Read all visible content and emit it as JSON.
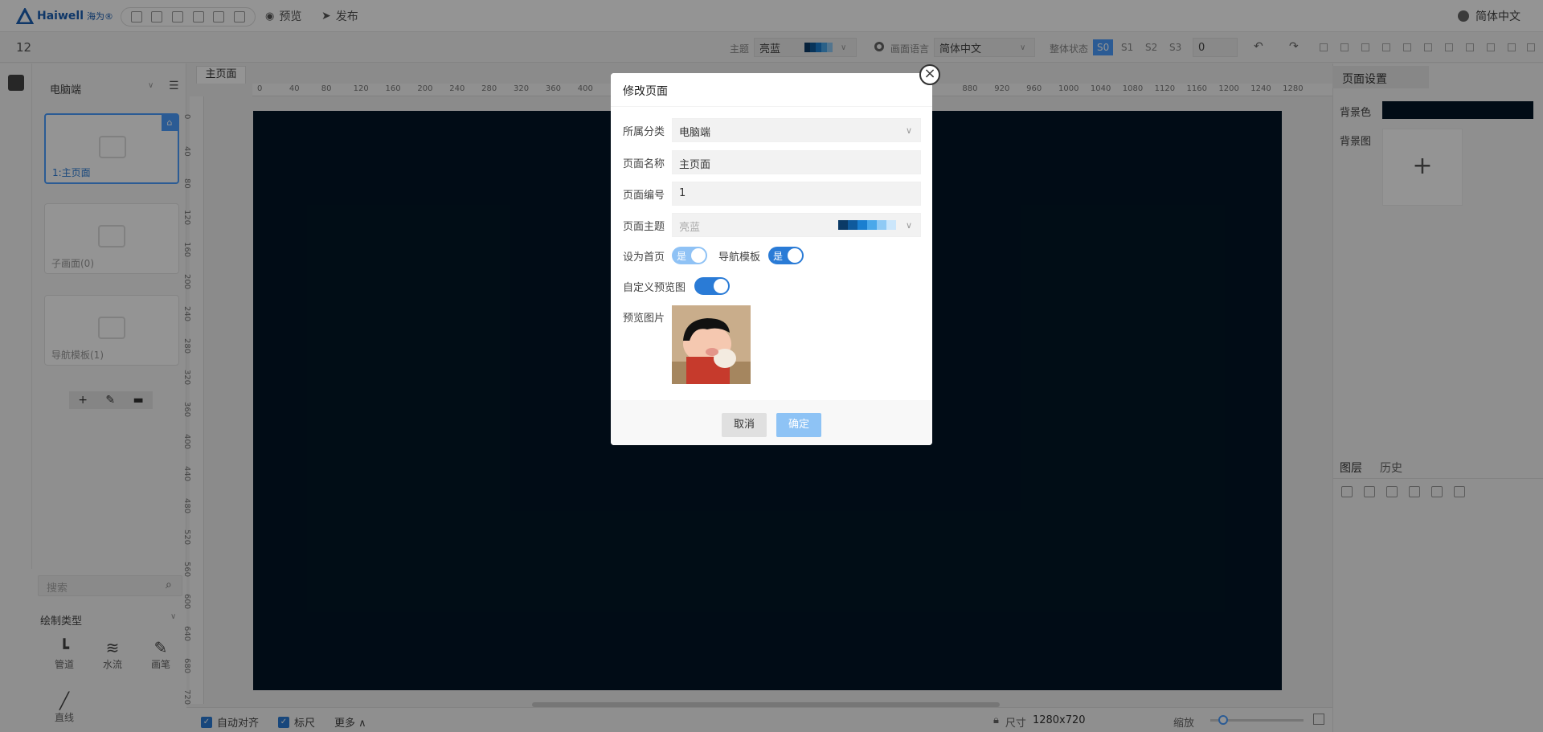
{
  "app": {
    "logo_text": "Haiwell",
    "logo_sub": "海为®",
    "preview_label": "预览",
    "publish_label": "发布",
    "language": "简体中文"
  },
  "toolbar": {
    "page_count": "12",
    "theme_label": "主题",
    "theme_value": "亮蓝",
    "screen_lang_label": "画面语言",
    "screen_lang_value": "简体中文",
    "state_label": "整体状态",
    "states": [
      "S0",
      "S1",
      "S2",
      "S3"
    ],
    "state_value": "0"
  },
  "left": {
    "category": "电脑端",
    "pages": [
      "1:主页面",
      "子画面(0)",
      "导航模板(1)"
    ],
    "search_placeholder": "搜索",
    "draw_type_label": "绘制类型",
    "tools": [
      "管道",
      "水流",
      "画笔",
      "直线"
    ]
  },
  "canvas": {
    "tab_label": "主页面",
    "ruler_top": [
      "0",
      "40",
      "80",
      "120",
      "160",
      "200",
      "240",
      "280",
      "320",
      "360",
      "400",
      "880",
      "920",
      "960",
      "1000",
      "1040",
      "1080",
      "1120",
      "1160",
      "1200",
      "1240",
      "1280"
    ],
    "ruler_left": [
      "0",
      "40",
      "80",
      "120",
      "160",
      "200",
      "240",
      "280",
      "320",
      "360",
      "400",
      "440",
      "480",
      "520",
      "560",
      "600",
      "640",
      "680",
      "720"
    ]
  },
  "right": {
    "title": "页面设置",
    "bg_color_label": "背景色",
    "bg_image_label": "背景图",
    "add_symbol": "+",
    "tab_layers": "图层",
    "tab_history": "历史",
    "bg_color": "#021626"
  },
  "bottom": {
    "auto_align": "自动对齐",
    "ruler": "标尺",
    "more": "更多",
    "size_label": "尺寸",
    "size_value": "1280x720",
    "zoom_label": "缩放"
  },
  "modal": {
    "title": "修改页面",
    "category_label": "所属分类",
    "category_value": "电脑端",
    "name_label": "页面名称",
    "name_value": "主页面",
    "number_label": "页面编号",
    "number_value": "1",
    "theme_label": "页面主题",
    "theme_value": "亮蓝",
    "home_label": "设为首页",
    "home_toggle": "是",
    "nav_label": "导航模板",
    "nav_toggle": "是",
    "custom_preview_label": "自定义预览图",
    "preview_label": "预览图片",
    "cancel": "取消",
    "confirm": "确定"
  }
}
